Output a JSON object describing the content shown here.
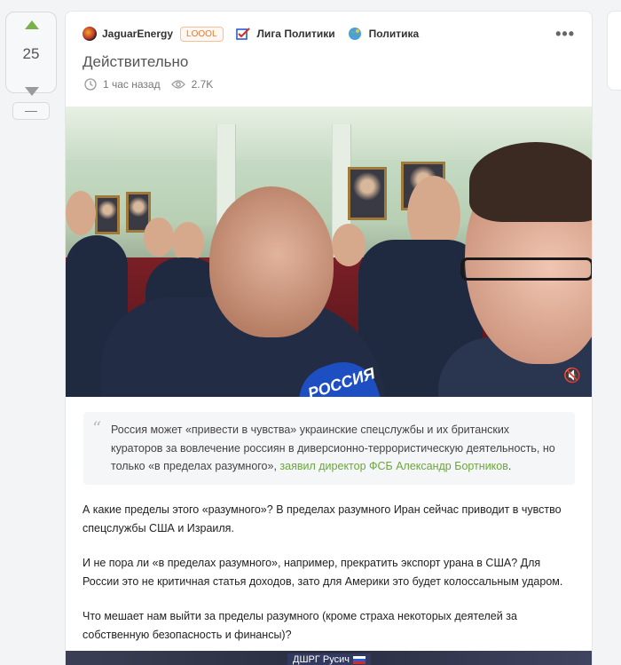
{
  "vote": {
    "count": "25",
    "collapse_label": "—"
  },
  "post": {
    "author": "JaguarEnergy",
    "badge": "LOOOL",
    "communities": [
      "Лига Политики",
      "Политика"
    ],
    "more_label": "•••",
    "title": "Действительно",
    "time": "1 час назад",
    "views": "2.7K"
  },
  "video": {
    "mic_text": "РОССИЯ",
    "mute_label": "🔇"
  },
  "quote": {
    "text": "Россия может «привести в чувства» украинские спецслужбы и их британских кураторов за вовлечение россиян в диверсионно-террористическую деятельность, но только «в пределах разумного», ",
    "link": "заявил директор ФСБ Александр Бортников",
    "end": "."
  },
  "paragraphs": [
    "А какие пределы этого «разумного»? В пределах разумного Иран сейчас приводит в чувство спецслужбы США и Израиля.",
    "И не пора ли «в пределах разумного», например, прекратить экспорт урана в США? Для России это не критичная статья доходов, зато для Америки это будет колоссальным ударом.",
    "Что мешает нам выйти за пределы разумного (кроме страха некоторых деятелей за собственную безопасность и финансы)?"
  ],
  "bottom_video": {
    "label": "ДШРГ Русич"
  },
  "colors": {
    "accent_green": "#7ab24a",
    "link_green": "#6aa83d",
    "badge_orange": "#e07a3a"
  }
}
